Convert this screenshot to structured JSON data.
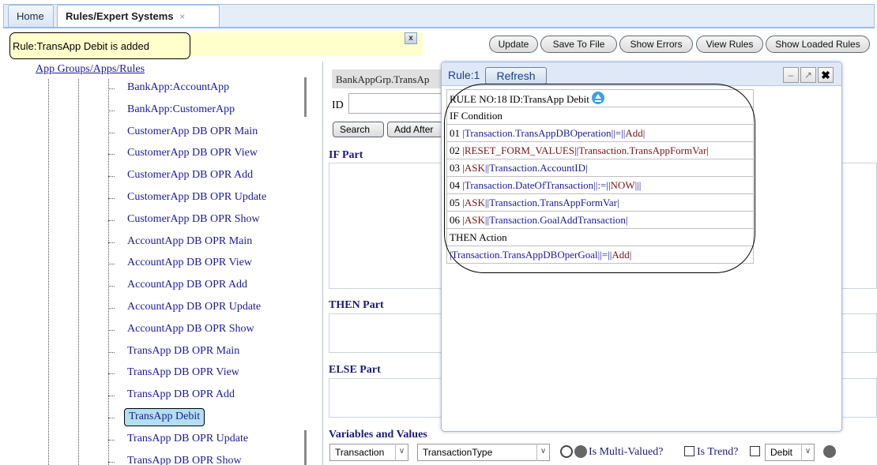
{
  "tabs": [
    {
      "label": "Home"
    },
    {
      "label": "Rules/Expert Systems",
      "close": "×"
    }
  ],
  "status": {
    "message": "Rule:TransApp Debit is added",
    "close_icon": "x"
  },
  "toolbar": {
    "update": "Update",
    "save_to_file": "Save To File",
    "show_errors": "Show Errors",
    "view_rules": "View Rules",
    "show_loaded_rules": "Show Loaded Rules"
  },
  "tree": {
    "title": "App Groups/Apps/Rules",
    "items": [
      "BankApp:AccountApp",
      "BankApp:CustomerApp",
      "CustomerApp DB OPR Main",
      "CustomerApp DB OPR View",
      "CustomerApp DB OPR Add",
      "CustomerApp DB OPR Update",
      "CustomerApp DB OPR Show",
      "AccountApp DB OPR Main",
      "AccountApp DB OPR View",
      "AccountApp DB OPR Add",
      "AccountApp DB OPR Update",
      "AccountApp DB OPR Show",
      "TransApp DB OPR Main",
      "TransApp DB OPR View",
      "TransApp DB OPR Add",
      "TransApp Debit",
      "TransApp DB OPR Update",
      "TransApp DB OPR Show"
    ],
    "selected_index": 15
  },
  "form": {
    "rule_path": "BankAppGrp.TransAp",
    "id_label": "ID",
    "id_value": "",
    "search_button": "Search",
    "add_after_button": "Add After",
    "if_part": "IF Part",
    "then_part": "THEN Part",
    "else_part": "ELSE Part",
    "variables_title": "Variables and Values",
    "var_select": "Transaction",
    "value_select": "TransactionType",
    "multi_valued_label": "Is Multi-Valued?",
    "trend_label": "Is Trend?",
    "trend_select": "Debit"
  },
  "popup": {
    "title": "Rule:1",
    "refresh": "Refresh",
    "rule_header": "RULE NO:18 ID:TransApp Debit",
    "if_condition": "IF Condition",
    "conditions": [
      {
        "num": "01",
        "parts": [
          [
            "bar",
            "|"
          ],
          [
            "blue",
            "Transaction.TransAppDBOperation"
          ],
          [
            "bar",
            "||=||"
          ],
          [
            "tok",
            "Add"
          ],
          [
            "bar",
            "|"
          ]
        ]
      },
      {
        "num": "02",
        "parts": [
          [
            "bar",
            "|"
          ],
          [
            "tok",
            "RESET_FORM_VALUES"
          ],
          [
            "bar",
            "||"
          ],
          [
            "tok",
            "Transaction.TransAppFormVar"
          ],
          [
            "bar",
            "|"
          ]
        ]
      },
      {
        "num": "03",
        "parts": [
          [
            "bar",
            "|"
          ],
          [
            "tok",
            "ASK"
          ],
          [
            "bar",
            "||"
          ],
          [
            "blue",
            "Transaction.AccountID"
          ],
          [
            "bar",
            "|"
          ]
        ]
      },
      {
        "num": "04",
        "parts": [
          [
            "bar",
            "|"
          ],
          [
            "blue",
            "Transaction.DateOfTransaction"
          ],
          [
            "bar",
            "||:=||"
          ],
          [
            "tok",
            "NOW"
          ],
          [
            "bar",
            "|||"
          ]
        ]
      },
      {
        "num": "05",
        "parts": [
          [
            "bar",
            "|"
          ],
          [
            "tok",
            "ASK"
          ],
          [
            "bar",
            "||"
          ],
          [
            "blue",
            "Transaction.TransAppFormVar"
          ],
          [
            "bar",
            "|"
          ]
        ]
      },
      {
        "num": "06",
        "parts": [
          [
            "bar",
            "|"
          ],
          [
            "tok",
            "ASK"
          ],
          [
            "bar",
            "||"
          ],
          [
            "blue",
            "Transaction.GoalAddTransaction"
          ],
          [
            "bar",
            "|"
          ]
        ]
      }
    ],
    "then_action": "THEN Action",
    "action_parts": [
      [
        "bar",
        "|"
      ],
      [
        "blue",
        "Transaction.TransAppDBOperGoal"
      ],
      [
        "bar",
        "||=||"
      ],
      [
        "tok",
        "Add"
      ],
      [
        "bar",
        "|"
      ]
    ]
  }
}
